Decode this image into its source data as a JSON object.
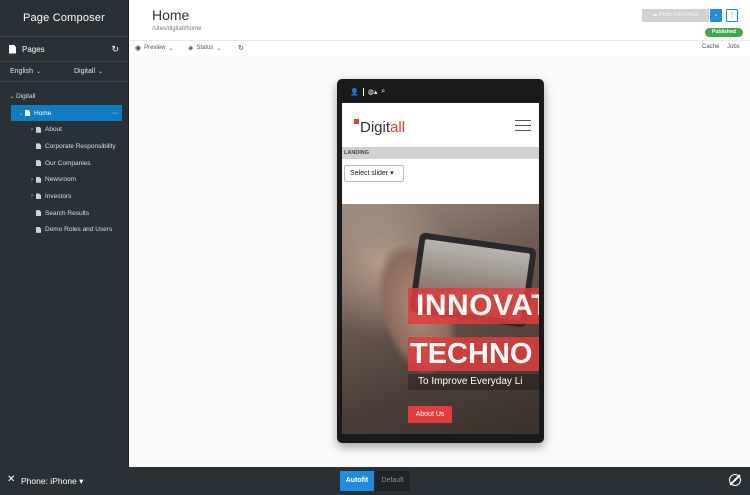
{
  "sidebar": {
    "title": "Page Composer",
    "pages_label": "Pages",
    "language": "English",
    "site": "Digitall",
    "tree": [
      {
        "label": "Digitall",
        "level": 0,
        "expanded": true,
        "chevron": "down"
      },
      {
        "label": "Home",
        "level": 1,
        "active": true,
        "chevron": "down"
      },
      {
        "label": "About",
        "level": 2,
        "chevron": "right"
      },
      {
        "label": "Corporate Responsibility",
        "level": 2,
        "chevron": ""
      },
      {
        "label": "Our Companies",
        "level": 2,
        "chevron": ""
      },
      {
        "label": "Newsroom",
        "level": 2,
        "chevron": "right"
      },
      {
        "label": "Investors",
        "level": 2,
        "chevron": "right"
      },
      {
        "label": "Search Results",
        "level": 2,
        "chevron": ""
      },
      {
        "label": "Demo Roles and Users",
        "level": 2,
        "chevron": ""
      }
    ]
  },
  "header": {
    "title": "Home",
    "path": "/sites/digitall/home",
    "publish_label": "PUBLISH PAGE",
    "status_badge": "Published"
  },
  "toolbar": {
    "preview": "Preview",
    "status": "Status",
    "cache": "Cache",
    "jobs": "Jobs"
  },
  "phone": {
    "brand_prefix": "Digit",
    "brand_suffix": "all",
    "landing_label": "LANDING",
    "select_slider": "Select slider",
    "hero_line1": "INNOVAT",
    "hero_line2": "TECHNO",
    "hero_sub": "To Improve Everyday Li",
    "about_button": "About Us"
  },
  "bottom": {
    "device_label": "Phone: iPhone",
    "autofit": "Autofit",
    "default": "Default"
  },
  "colors": {
    "sidebar_bg": "#293136",
    "accent_blue": "#1f8ce0",
    "published_green": "#3fa94b",
    "brand_red": "#e23c3c"
  }
}
